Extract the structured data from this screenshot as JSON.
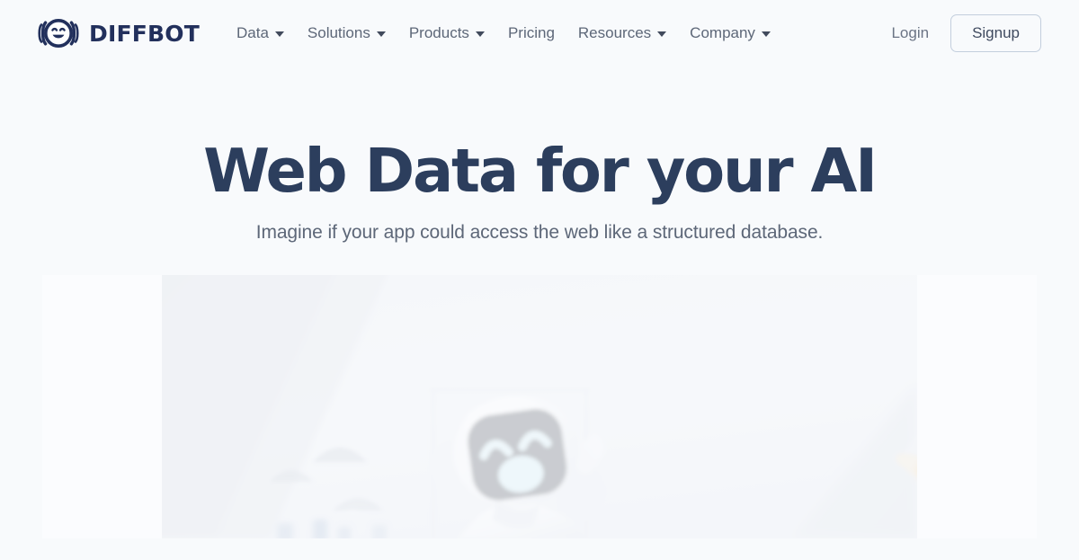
{
  "brand": {
    "name": "DIFFBOT",
    "logo_icon": "robot-face-logo"
  },
  "nav": {
    "items": [
      {
        "label": "Data",
        "has_dropdown": true,
        "icon": "chevron-down-icon"
      },
      {
        "label": "Solutions",
        "has_dropdown": true,
        "icon": "chevron-down-icon"
      },
      {
        "label": "Products",
        "has_dropdown": true,
        "icon": "chevron-down-icon"
      },
      {
        "label": "Pricing",
        "has_dropdown": false,
        "icon": ""
      },
      {
        "label": "Resources",
        "has_dropdown": true,
        "icon": "chevron-down-icon"
      },
      {
        "label": "Company",
        "has_dropdown": true,
        "icon": "chevron-down-icon"
      }
    ]
  },
  "account": {
    "login_label": "Login",
    "signup_label": "Signup"
  },
  "hero": {
    "title": "Web Data for your AI",
    "subtitle": "Imagine if your app could access the web like a structured database.",
    "media_alt": "smiling-white-robot-waving-in-bright-room"
  },
  "colors": {
    "page_background": "#f8fafc",
    "brand_navy": "#22305c",
    "heading_navy": "#2c3e5d",
    "body_slate": "#5d6778",
    "button_border": "#c3cedd",
    "media_background": "#eef1f5"
  }
}
